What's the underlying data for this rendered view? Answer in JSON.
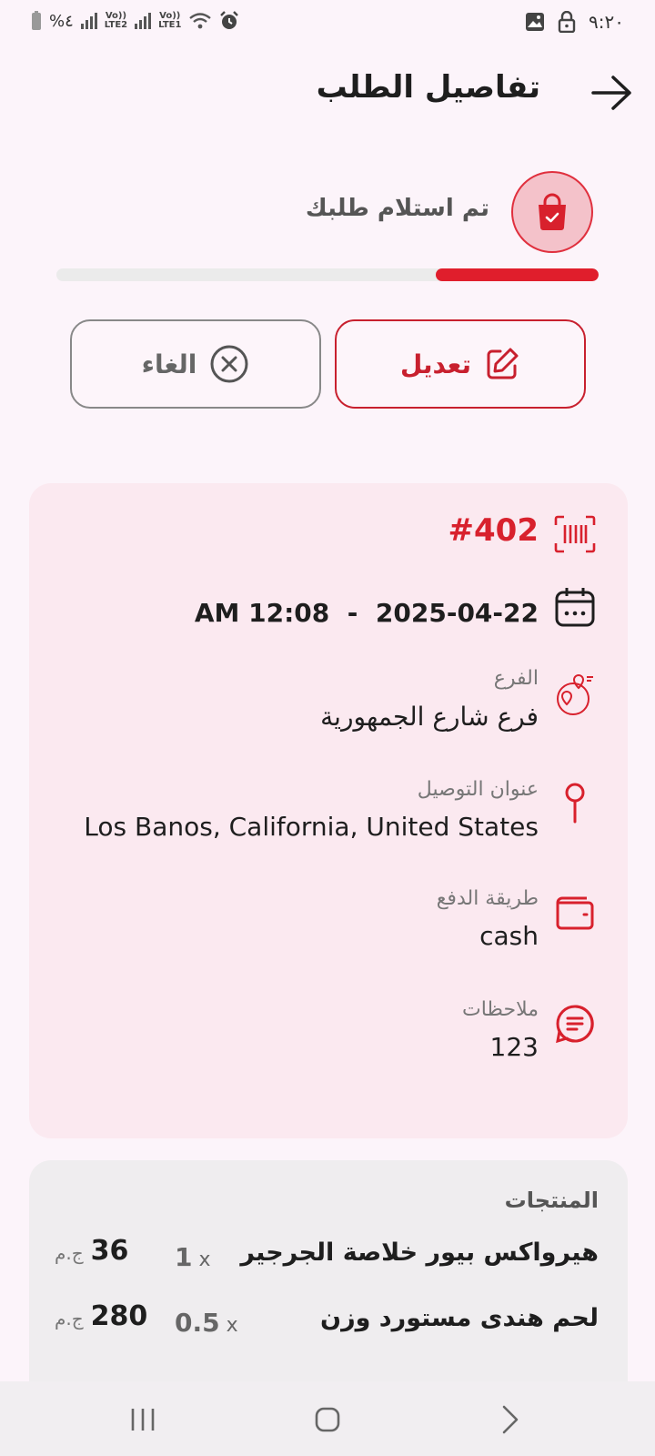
{
  "status_bar": {
    "time": "٩:٢٠",
    "battery": "%٤",
    "sim2": [
      "Vo))",
      "LTE2"
    ],
    "sim1": [
      "Vo))",
      "LTE1"
    ]
  },
  "header": {
    "title": "تفاصيل الطلب",
    "back_icon": "arrow-right-icon"
  },
  "order_status": {
    "text": "تم استلام طلبك",
    "icon": "shopping-bag-check-icon",
    "progress": 0.3,
    "accent": "#e01e2c"
  },
  "actions": {
    "edit_label": "تعديل",
    "cancel_label": "الغاء"
  },
  "details": {
    "order_number": "#402",
    "date": "2025-04-22",
    "time": "AM 12:08",
    "branch_label": "الفرع",
    "branch_value": "فرع شارع الجمهورية",
    "address_label": "عنوان التوصيل",
    "address_value": "Los Banos, California, United States",
    "payment_label": "طريقة الدفع",
    "payment_value": "cash",
    "notes_label": "ملاحظات",
    "notes_value": "123"
  },
  "products": {
    "heading": "المنتجات",
    "currency": "ج.م",
    "items": [
      {
        "name": "هيرواكس بيور خلاصة الجرجير",
        "qty": "1",
        "price": "36"
      },
      {
        "name": "لحم هندى مستورد وزن",
        "qty": "0.5",
        "price": "280"
      }
    ]
  }
}
